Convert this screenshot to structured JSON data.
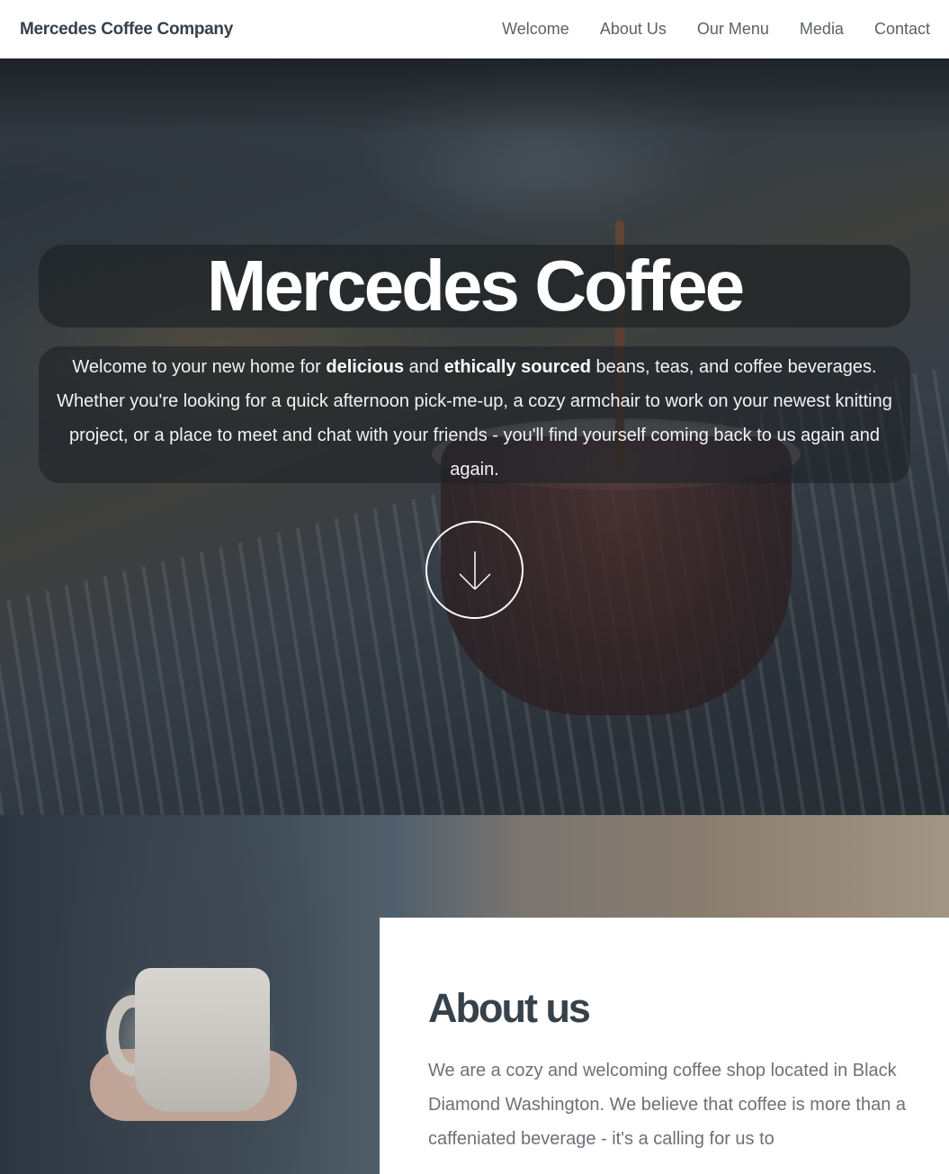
{
  "nav": {
    "brand": "Mercedes Coffee Company",
    "links": [
      "Welcome",
      "About Us",
      "Our Menu",
      "Media",
      "Contact"
    ]
  },
  "hero": {
    "title": "Mercedes Coffee",
    "intro_start": "Welcome to your new home for ",
    "intro_bold1": "delicious",
    "intro_mid": " and ",
    "intro_bold2": "ethically sourced",
    "intro_end": " beans, teas, and coffee beverages. Whether you're looking for a quick afternoon pick-me-up, a cozy armchair to work on your newest knitting project, or a place to meet and chat with your friends - you'll find yourself coming back to us again and again.",
    "scroll_icon": "arrow-down-icon"
  },
  "about": {
    "title": "About us",
    "text": "We are a cozy and welcoming coffee shop located in Black Diamond Washington. We believe that coffee is more than a caffeniated beverage - it's a calling for us to"
  }
}
